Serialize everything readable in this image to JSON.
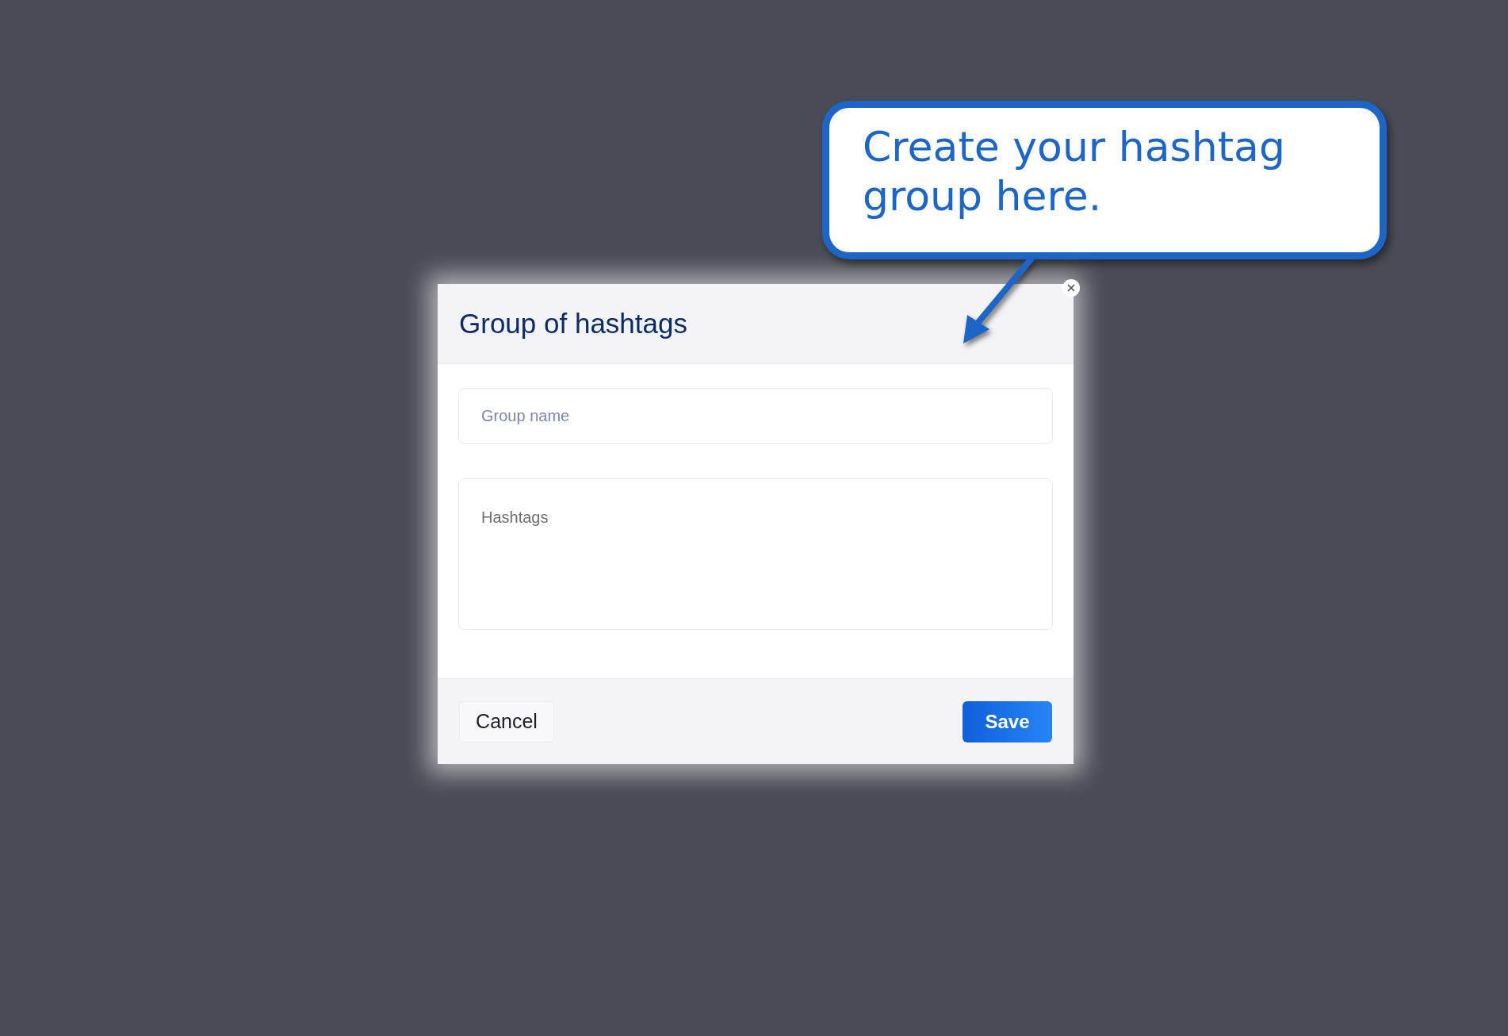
{
  "callout": {
    "text": "Create your hashtag group here."
  },
  "dialog": {
    "title": "Group of hashtags",
    "fields": [
      {
        "kind": "input",
        "placeholder": "Group name"
      },
      {
        "kind": "textarea",
        "placeholder": "Hashtags"
      }
    ],
    "buttons": [
      {
        "label": "Cancel",
        "kind": "secondary"
      },
      {
        "label": "Save",
        "kind": "primary"
      }
    ]
  }
}
